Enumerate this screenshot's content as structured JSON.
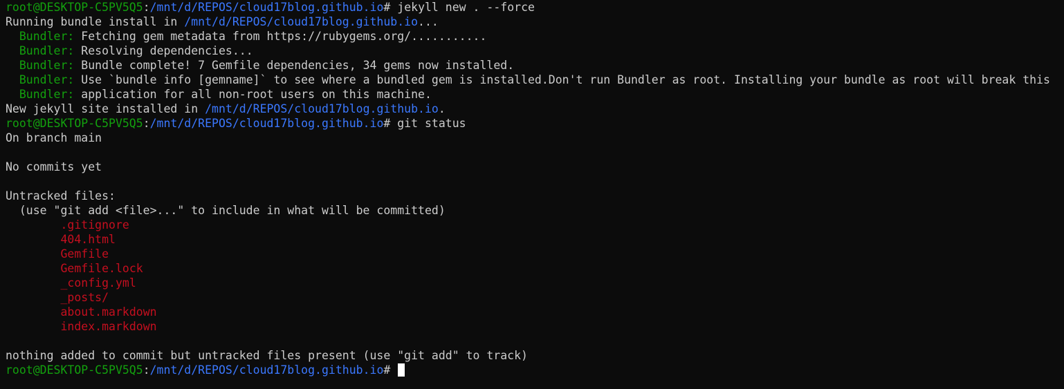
{
  "colors": {
    "background": "#0c0c0c",
    "text": "#cccccc",
    "prompt_user": "#13a10e",
    "prompt_path": "#3b78ff",
    "untracked_file": "#c50f1f",
    "cursor": "#ffffff"
  },
  "lines": [
    {
      "type": "prompt",
      "user": "root@DESKTOP-C5PV5Q5",
      "sep": ":",
      "path": "/mnt/d/REPOS/cloud17blog.github.io",
      "symbol": "# ",
      "command": "jekyll new . --force"
    },
    {
      "type": "info_path",
      "prefix": "Running bundle install in ",
      "path": "/mnt/d/REPOS/cloud17blog.github.io",
      "suffix": "..."
    },
    {
      "type": "bundler",
      "indent": "  ",
      "label": "Bundler:",
      "text": " Fetching gem metadata from https://rubygems.org/..........."
    },
    {
      "type": "bundler",
      "indent": "  ",
      "label": "Bundler:",
      "text": " Resolving dependencies..."
    },
    {
      "type": "bundler",
      "indent": "  ",
      "label": "Bundler:",
      "text": " Bundle complete! 7 Gemfile dependencies, 34 gems now installed."
    },
    {
      "type": "bundler",
      "indent": "  ",
      "label": "Bundler:",
      "text": " Use `bundle info [gemname]` to see where a bundled gem is installed.Don't run Bundler as root. Installing your bundle as root will break this"
    },
    {
      "type": "bundler",
      "indent": "  ",
      "label": "Bundler:",
      "text": " application for all non-root users on this machine."
    },
    {
      "type": "info_path",
      "prefix": "New jekyll site installed in ",
      "path": "/mnt/d/REPOS/cloud17blog.github.io",
      "suffix": "."
    },
    {
      "type": "prompt",
      "user": "root@DESKTOP-C5PV5Q5",
      "sep": ":",
      "path": "/mnt/d/REPOS/cloud17blog.github.io",
      "symbol": "# ",
      "command": "git status"
    },
    {
      "type": "text",
      "text": "On branch main"
    },
    {
      "type": "text",
      "text": ""
    },
    {
      "type": "text",
      "text": "No commits yet"
    },
    {
      "type": "text",
      "text": ""
    },
    {
      "type": "text",
      "text": "Untracked files:"
    },
    {
      "type": "text",
      "text": "  (use \"git add <file>...\" to include in what will be committed)"
    },
    {
      "type": "file",
      "indent": "        ",
      "text": ".gitignore"
    },
    {
      "type": "file",
      "indent": "        ",
      "text": "404.html"
    },
    {
      "type": "file",
      "indent": "        ",
      "text": "Gemfile"
    },
    {
      "type": "file",
      "indent": "        ",
      "text": "Gemfile.lock"
    },
    {
      "type": "file",
      "indent": "        ",
      "text": "_config.yml"
    },
    {
      "type": "file",
      "indent": "        ",
      "text": "_posts/"
    },
    {
      "type": "file",
      "indent": "        ",
      "text": "about.markdown"
    },
    {
      "type": "file",
      "indent": "        ",
      "text": "index.markdown"
    },
    {
      "type": "text",
      "text": ""
    },
    {
      "type": "text",
      "text": "nothing added to commit but untracked files present (use \"git add\" to track)"
    },
    {
      "type": "prompt",
      "user": "root@DESKTOP-C5PV5Q5",
      "sep": ":",
      "path": "/mnt/d/REPOS/cloud17blog.github.io",
      "symbol": "# ",
      "command": "",
      "cursor": true
    }
  ]
}
